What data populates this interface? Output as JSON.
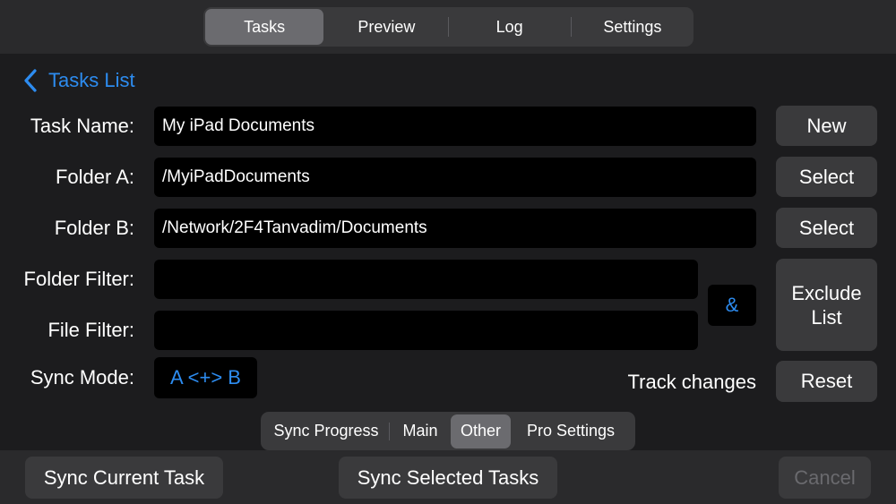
{
  "tabs": [
    {
      "label": "Tasks",
      "active": true
    },
    {
      "label": "Preview",
      "active": false
    },
    {
      "label": "Log",
      "active": false
    },
    {
      "label": "Settings",
      "active": false
    }
  ],
  "nav": {
    "back_label": "Tasks List",
    "icon": "chevron-left-icon"
  },
  "form": {
    "task_name_label": "Task Name:",
    "task_name_value": "My iPad Documents",
    "folder_a_label": "Folder A:",
    "folder_a_value": "/MyiPadDocuments",
    "folder_b_label": "Folder B:",
    "folder_b_value": "/Network/2F4Tanvadim/Documents",
    "folder_filter_label": "Folder Filter:",
    "folder_filter_value": "",
    "file_filter_label": "File Filter:",
    "file_filter_value": "",
    "sync_mode_label": "Sync Mode:",
    "sync_mode_value": "A <+> B",
    "filter_join": "&",
    "track_changes_label": "Track changes"
  },
  "side_buttons": {
    "new": "New",
    "select_a": "Select",
    "select_b": "Select",
    "exclude_list_line1": "Exclude",
    "exclude_list_line2": "List",
    "reset": "Reset"
  },
  "subtabs": [
    {
      "label": "Sync Progress",
      "active": false
    },
    {
      "label": "Main",
      "active": false
    },
    {
      "label": "Other",
      "active": true
    },
    {
      "label": "Pro Settings",
      "active": false
    }
  ],
  "bottom": {
    "sync_current": "Sync Current Task",
    "sync_selected": "Sync Selected Tasks",
    "cancel": "Cancel"
  },
  "colors": {
    "accent": "#2d8cf0",
    "background": "#1c1c1e",
    "control": "#3a3a3c"
  }
}
